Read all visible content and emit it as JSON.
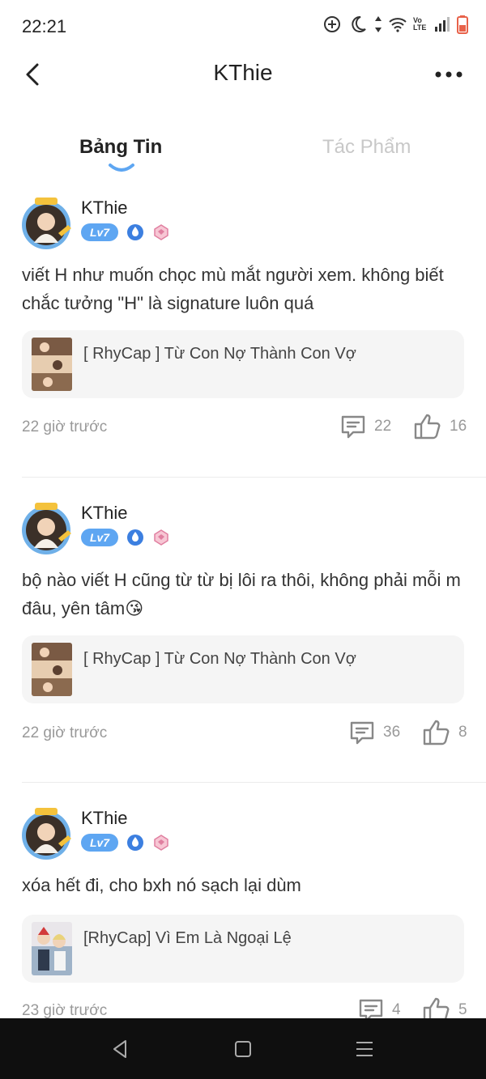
{
  "status_bar": {
    "time": "22:21",
    "icons": [
      "sync-icon",
      "moon-icon",
      "data-arrows-icon",
      "wifi-icon",
      "volte-icon",
      "signal-icon",
      "battery-icon"
    ],
    "volte_text": "Vo LTE"
  },
  "header": {
    "title": "KThie",
    "back_icon": "chevron-left-icon",
    "more_icon": "more-dots-icon"
  },
  "tabs": [
    {
      "label": "Bảng Tin",
      "active": true
    },
    {
      "label": "Tác Phẩm",
      "active": false
    }
  ],
  "colors": {
    "level_badge": "#5ea6f2",
    "tab_indicator": "#5ea6f2",
    "inactive_tab": "#c8c8c8",
    "meta_text": "#999999",
    "card_bg": "#f5f5f5",
    "nav_bar_bg": "#0f0f0f"
  },
  "posts": [
    {
      "author": "KThie",
      "level": "Lv7",
      "text": "viết H như muốn chọc mù mắt người xem. không biết chắc tưởng \"H\" là signature luôn quá",
      "book_title": "[ RhyCap ] Từ Con Nợ Thành Con Vợ",
      "time": "22 giờ trước",
      "comments": "22",
      "likes": "16"
    },
    {
      "author": "KThie",
      "level": "Lv7",
      "text": "bộ nào viết H cũng từ từ bị lôi ra thôi, không phải mỗi m đâu, yên tâm😘",
      "book_title": "[ RhyCap ] Từ Con Nợ Thành Con Vợ",
      "time": "22 giờ trước",
      "comments": "36",
      "likes": "8"
    },
    {
      "author": "KThie",
      "level": "Lv7",
      "text": "xóa hết đi, cho bxh nó sạch lại dùm",
      "book_title": "[RhyCap] Vì Em Là Ngoại Lệ",
      "time": "23 giờ trước",
      "comments": "4",
      "likes": "5"
    }
  ],
  "system_nav": [
    "back-triangle-icon",
    "home-square-icon",
    "menu-lines-icon"
  ]
}
